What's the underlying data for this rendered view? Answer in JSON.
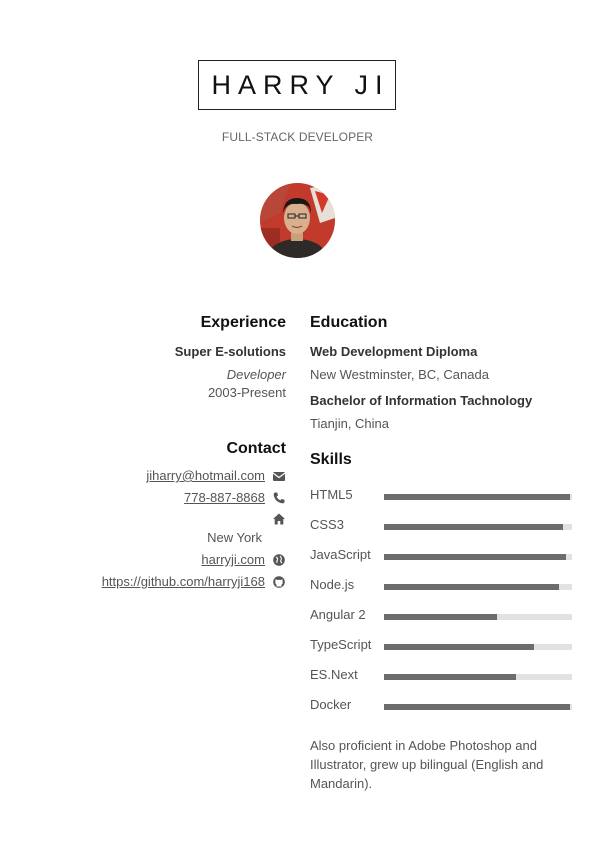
{
  "header": {
    "name": "HARRY JI",
    "title": "FULL-STACK DEVELOPER"
  },
  "experience": {
    "heading": "Experience",
    "company": "Super E-solutions",
    "role": "Developer",
    "period": "2003-Present"
  },
  "contact": {
    "heading": "Contact",
    "email": "jiharry@hotmail.com",
    "phone": "778-887-8868",
    "location": "New York",
    "website": "harryji.com",
    "github": "https://github.com/harryji168"
  },
  "education": {
    "heading": "Education",
    "items": [
      {
        "degree": "Web Development Diploma",
        "place": "New Westminster, BC, Canada"
      },
      {
        "degree": "Bachelor of Information Tachnology",
        "place": "Tianjin, China"
      }
    ]
  },
  "skills": {
    "heading": "Skills",
    "items": [
      {
        "label": "HTML5",
        "level": 0.99
      },
      {
        "label": "CSS3",
        "level": 0.95
      },
      {
        "label": "JavaScript",
        "level": 0.97
      },
      {
        "label": "Node.js",
        "level": 0.93
      },
      {
        "label": "Angular 2",
        "level": 0.6
      },
      {
        "label": "TypeScript",
        "level": 0.8
      },
      {
        "label": "ES.Next",
        "level": 0.7
      },
      {
        "label": "Docker",
        "level": 0.99
      }
    ],
    "note": "Also proficient in Adobe Photoshop and Illustrator, grew up bilingual (English and Mandarin)."
  },
  "colors": {
    "bar_fill": "#6c6c6c",
    "bar_track": "#e2e2e2"
  },
  "icons": [
    "envelope-icon",
    "phone-icon",
    "home-icon",
    "globe-icon",
    "github-icon"
  ]
}
